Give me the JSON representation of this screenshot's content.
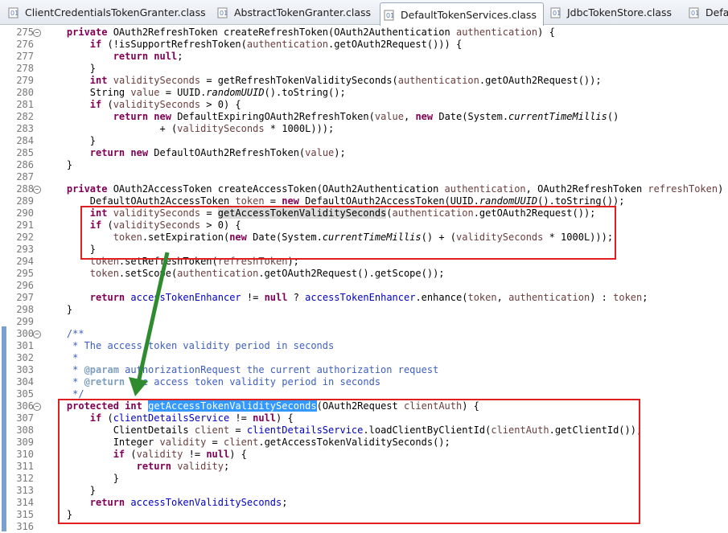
{
  "tabs": [
    {
      "label": "ClientCredentialsTokenGranter.class",
      "active": false
    },
    {
      "label": "AbstractTokenGranter.class",
      "active": false
    },
    {
      "label": "DefaultTokenServices.class",
      "active": true
    },
    {
      "label": "JdbcTokenStore.class",
      "active": false
    },
    {
      "label": "Defau",
      "active": false
    }
  ],
  "lines": [
    {
      "n": "275",
      "fold": "−",
      "t": [
        [
          "    "
        ],
        [
          "private",
          "kw"
        ],
        [
          " OAuth2RefreshToken createRefreshToken(OAuth2Authentication "
        ],
        [
          "authentication",
          "pv"
        ],
        [
          ") {"
        ]
      ]
    },
    {
      "n": "276",
      "t": [
        [
          "        "
        ],
        [
          "if",
          "kw"
        ],
        [
          " (!isSupportRefreshToken("
        ],
        [
          "authentication",
          "pv"
        ],
        [
          ".getOAuth2Request())) {"
        ]
      ]
    },
    {
      "n": "277",
      "t": [
        [
          "            "
        ],
        [
          "return",
          "kw"
        ],
        [
          " "
        ],
        [
          "null",
          "kw"
        ],
        [
          ";"
        ]
      ]
    },
    {
      "n": "278",
      "t": [
        [
          "        }"
        ]
      ]
    },
    {
      "n": "279",
      "t": [
        [
          "        "
        ],
        [
          "int",
          "kw"
        ],
        [
          " "
        ],
        [
          "validitySeconds",
          "pv"
        ],
        [
          " = getRefreshTokenValiditySeconds("
        ],
        [
          "authentication",
          "pv"
        ],
        [
          ".getOAuth2Request());"
        ]
      ]
    },
    {
      "n": "280",
      "t": [
        [
          "        String "
        ],
        [
          "value",
          "pv"
        ],
        [
          " = UUID."
        ],
        [
          "randomUUID",
          "it"
        ],
        [
          "().toString();"
        ]
      ]
    },
    {
      "n": "281",
      "t": [
        [
          "        "
        ],
        [
          "if",
          "kw"
        ],
        [
          " ("
        ],
        [
          "validitySeconds",
          "pv"
        ],
        [
          " > 0) {"
        ]
      ]
    },
    {
      "n": "282",
      "t": [
        [
          "            "
        ],
        [
          "return",
          "kw"
        ],
        [
          " "
        ],
        [
          "new",
          "kw"
        ],
        [
          " DefaultExpiringOAuth2RefreshToken("
        ],
        [
          "value",
          "pv"
        ],
        [
          ", "
        ],
        [
          "new",
          "kw"
        ],
        [
          " Date(System."
        ],
        [
          "currentTimeMillis",
          "it"
        ],
        [
          "()"
        ]
      ]
    },
    {
      "n": "283",
      "t": [
        [
          "                    + ("
        ],
        [
          "validitySeconds",
          "pv"
        ],
        [
          " * 1000L)));"
        ]
      ]
    },
    {
      "n": "284",
      "t": [
        [
          "        }"
        ]
      ]
    },
    {
      "n": "285",
      "t": [
        [
          "        "
        ],
        [
          "return",
          "kw"
        ],
        [
          " "
        ],
        [
          "new",
          "kw"
        ],
        [
          " DefaultOAuth2RefreshToken("
        ],
        [
          "value",
          "pv"
        ],
        [
          ");"
        ]
      ]
    },
    {
      "n": "286",
      "t": [
        [
          "    }"
        ]
      ]
    },
    {
      "n": "287",
      "t": [
        [
          ""
        ]
      ]
    },
    {
      "n": "288",
      "fold": "−",
      "t": [
        [
          "    "
        ],
        [
          "private",
          "kw"
        ],
        [
          " OAuth2AccessToken createAccessToken(OAuth2Authentication "
        ],
        [
          "authentication",
          "pv"
        ],
        [
          ", OAuth2RefreshToken "
        ],
        [
          "refreshToken",
          "pv"
        ],
        [
          ") {"
        ]
      ]
    },
    {
      "n": "289",
      "t": [
        [
          "        DefaultOAuth2AccessToken "
        ],
        [
          "token",
          "pv"
        ],
        [
          " = "
        ],
        [
          "new",
          "kw"
        ],
        [
          " DefaultOAuth2AccessToken(UUID."
        ],
        [
          "randomUUID",
          "it"
        ],
        [
          "().toString());"
        ]
      ]
    },
    {
      "n": "290",
      "t": [
        [
          "        "
        ],
        [
          "int",
          "kw"
        ],
        [
          " "
        ],
        [
          "validitySeconds",
          "pv"
        ],
        [
          " = "
        ],
        [
          "getAccessTokenValiditySeconds",
          "hl"
        ],
        [
          "("
        ],
        [
          "authentication",
          "pv"
        ],
        [
          ".getOAuth2Request());"
        ]
      ]
    },
    {
      "n": "291",
      "t": [
        [
          "        "
        ],
        [
          "if",
          "kw"
        ],
        [
          " ("
        ],
        [
          "validitySeconds",
          "pv"
        ],
        [
          " > 0) {"
        ]
      ]
    },
    {
      "n": "292",
      "t": [
        [
          "            "
        ],
        [
          "token",
          "pv"
        ],
        [
          ".setExpiration("
        ],
        [
          "new",
          "kw"
        ],
        [
          " Date(System."
        ],
        [
          "currentTimeMillis",
          "it"
        ],
        [
          "() + ("
        ],
        [
          "validitySeconds",
          "pv"
        ],
        [
          " * 1000L)));"
        ]
      ]
    },
    {
      "n": "293",
      "t": [
        [
          "        }"
        ]
      ]
    },
    {
      "n": "294",
      "t": [
        [
          "        "
        ],
        [
          "token",
          "pv"
        ],
        [
          ".setRefreshToken("
        ],
        [
          "refreshToken",
          "pv"
        ],
        [
          ");"
        ]
      ]
    },
    {
      "n": "295",
      "t": [
        [
          "        "
        ],
        [
          "token",
          "pv"
        ],
        [
          ".setScope("
        ],
        [
          "authentication",
          "pv"
        ],
        [
          ".getOAuth2Request().getScope());"
        ]
      ]
    },
    {
      "n": "296",
      "t": [
        [
          ""
        ]
      ]
    },
    {
      "n": "297",
      "t": [
        [
          "        "
        ],
        [
          "return",
          "kw"
        ],
        [
          " "
        ],
        [
          "accessTokenEnhancer",
          "fd"
        ],
        [
          " != "
        ],
        [
          "null",
          "kw"
        ],
        [
          " ? "
        ],
        [
          "accessTokenEnhancer",
          "fd"
        ],
        [
          ".enhance("
        ],
        [
          "token",
          "pv"
        ],
        [
          ", "
        ],
        [
          "authentication",
          "pv"
        ],
        [
          ") : "
        ],
        [
          "token",
          "pv"
        ],
        [
          ";"
        ]
      ]
    },
    {
      "n": "298",
      "t": [
        [
          "    }"
        ]
      ]
    },
    {
      "n": "299",
      "t": [
        [
          ""
        ]
      ]
    },
    {
      "n": "300",
      "fold": "−",
      "t": [
        [
          "    /**",
          "cm"
        ]
      ]
    },
    {
      "n": "301",
      "t": [
        [
          "     * The access token validity period in seconds",
          "cm"
        ]
      ]
    },
    {
      "n": "302",
      "t": [
        [
          "     *",
          "cm"
        ]
      ]
    },
    {
      "n": "303",
      "t": [
        [
          "     * ",
          "cm"
        ],
        [
          "@param",
          "tg"
        ],
        [
          " authorizationRequest the current authorization request",
          "cm"
        ]
      ]
    },
    {
      "n": "304",
      "t": [
        [
          "     * ",
          "cm"
        ],
        [
          "@return",
          "tg"
        ],
        [
          " the access token validity period in seconds",
          "cm"
        ]
      ]
    },
    {
      "n": "305",
      "t": [
        [
          "     */",
          "cm"
        ]
      ]
    },
    {
      "n": "306",
      "fold": "−",
      "t": [
        [
          "    "
        ],
        [
          "protected",
          "kw"
        ],
        [
          " "
        ],
        [
          "int",
          "kw"
        ],
        [
          " "
        ],
        [
          "getAccessTokenValiditySeconds",
          "sel"
        ],
        [
          "(OAuth2Request "
        ],
        [
          "clientAuth",
          "pv"
        ],
        [
          ") {"
        ]
      ]
    },
    {
      "n": "307",
      "t": [
        [
          "        "
        ],
        [
          "if",
          "kw"
        ],
        [
          " ("
        ],
        [
          "clientDetailsService",
          "fd"
        ],
        [
          " != "
        ],
        [
          "null",
          "kw"
        ],
        [
          ") {"
        ]
      ]
    },
    {
      "n": "308",
      "t": [
        [
          "            ClientDetails "
        ],
        [
          "client",
          "pv"
        ],
        [
          " = "
        ],
        [
          "clientDetailsService",
          "fd"
        ],
        [
          ".loadClientByClientId("
        ],
        [
          "clientAuth",
          "pv"
        ],
        [
          ".getClientId());"
        ]
      ]
    },
    {
      "n": "309",
      "t": [
        [
          "            Integer "
        ],
        [
          "validity",
          "pv"
        ],
        [
          " = "
        ],
        [
          "client",
          "pv"
        ],
        [
          ".getAccessTokenValiditySeconds();"
        ]
      ]
    },
    {
      "n": "310",
      "t": [
        [
          "            "
        ],
        [
          "if",
          "kw"
        ],
        [
          " ("
        ],
        [
          "validity",
          "pv"
        ],
        [
          " != "
        ],
        [
          "null",
          "kw"
        ],
        [
          ") {"
        ]
      ]
    },
    {
      "n": "311",
      "t": [
        [
          "                "
        ],
        [
          "return",
          "kw"
        ],
        [
          " "
        ],
        [
          "validity",
          "pv"
        ],
        [
          ";"
        ]
      ]
    },
    {
      "n": "312",
      "t": [
        [
          "            }"
        ]
      ]
    },
    {
      "n": "313",
      "t": [
        [
          "        }"
        ]
      ]
    },
    {
      "n": "314",
      "t": [
        [
          "        "
        ],
        [
          "return",
          "kw"
        ],
        [
          " "
        ],
        [
          "accessTokenValiditySeconds",
          "fd"
        ],
        [
          ";"
        ]
      ]
    },
    {
      "n": "315",
      "t": [
        [
          "    }"
        ]
      ]
    },
    {
      "n": "316",
      "t": [
        [
          ""
        ]
      ]
    }
  ],
  "colors": {
    "keyword": "#7f0055",
    "local": "#6a3e3e",
    "field": "#0000c0",
    "comment": "#3f5fbf",
    "annotation_box": "#e02020",
    "arrow": "#2e8b2e",
    "selection": "#3399ff"
  }
}
